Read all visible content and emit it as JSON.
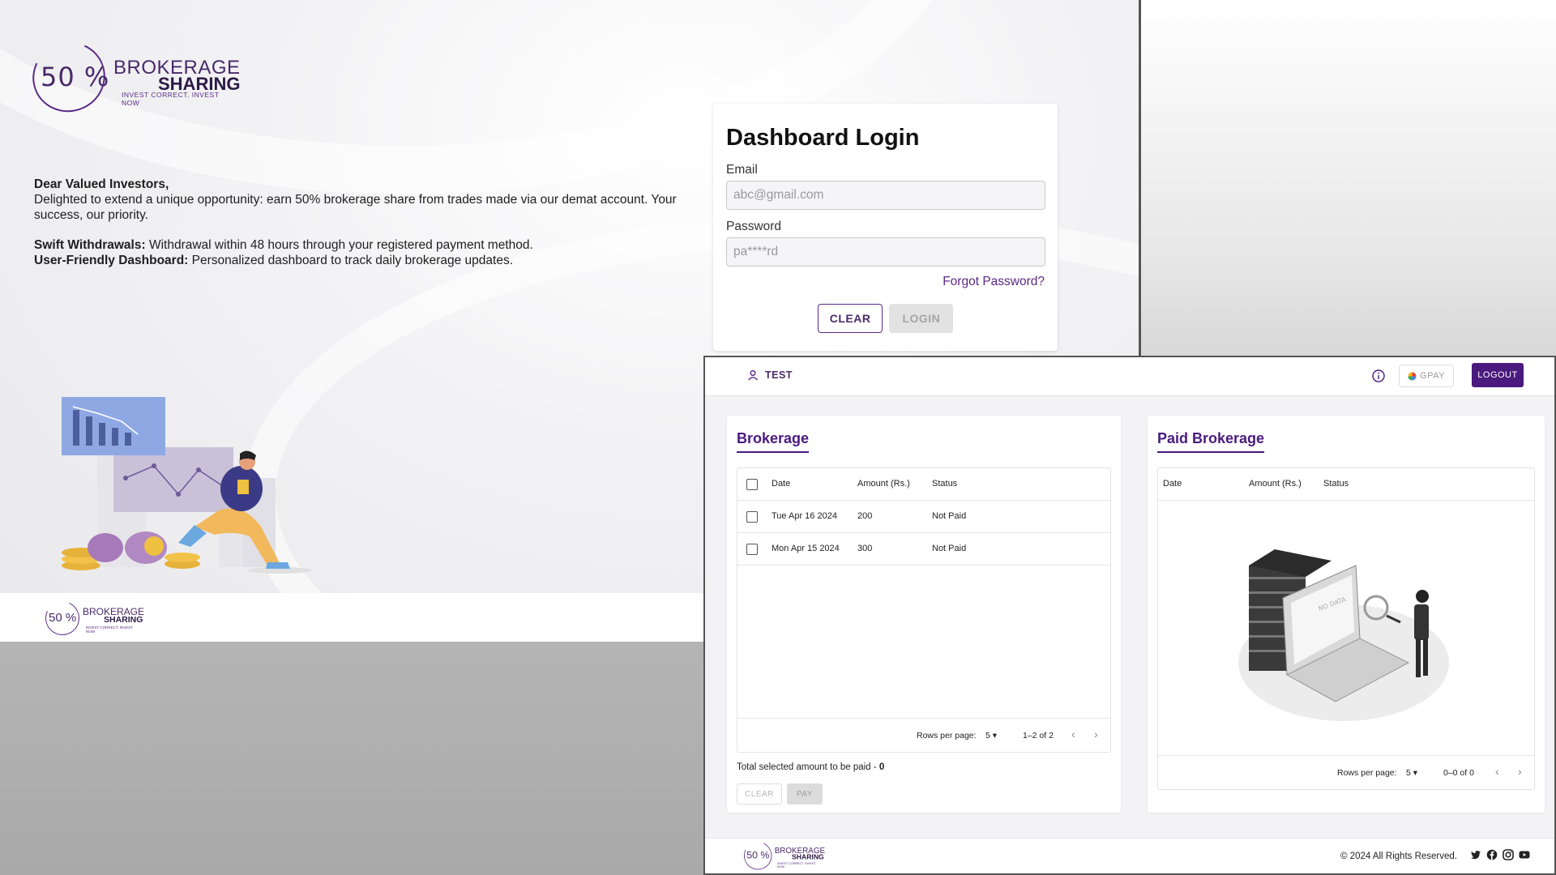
{
  "brand": {
    "percent": "50 %",
    "word1": "BROKERAGE",
    "word2": "SHARING",
    "tagline": "INVEST CORRECT. INVEST NOW"
  },
  "intro": {
    "greeting": "Dear Valued Investors,",
    "body": "Delighted to extend a unique opportunity: earn 50% brokerage share from trades made via our demat account. Your success, our priority.",
    "feature1_title": "Swift Withdrawals:",
    "feature1_text": " Withdrawal within 48 hours through your registered payment method.",
    "feature2_title": "User-Friendly Dashboard:",
    "feature2_text": " Personalized dashboard to track daily brokerage updates."
  },
  "login": {
    "title": "Dashboard Login",
    "email_label": "Email",
    "email_placeholder": "abc@gmail.com",
    "password_label": "Password",
    "password_placeholder": "pa****rd",
    "forgot": "Forgot Password?",
    "clear_label": "CLEAR",
    "login_label": "LOGIN"
  },
  "dashboard": {
    "user_name": "TEST",
    "gpay_label": "GPAY",
    "logout_label": "LOGOUT",
    "brokerage": {
      "title": "Brokerage",
      "columns": [
        "Date",
        "Amount (Rs.)",
        "Status"
      ],
      "rows": [
        {
          "date": "Tue Apr 16 2024",
          "amount": "200",
          "status": "Not Paid"
        },
        {
          "date": "Mon Apr 15 2024",
          "amount": "300",
          "status": "Not Paid"
        }
      ],
      "rows_per_page_label": "Rows per page:",
      "rows_per_page": "5",
      "range": "1–2 of 2",
      "total_label": "Total selected amount to be paid - ",
      "total_value": "0",
      "clear_label": "CLEAR",
      "pay_label": "PAY"
    },
    "paid": {
      "title": "Paid Brokerage",
      "columns": [
        "Date",
        "Amount (Rs.)",
        "Status"
      ],
      "empty_image_text": "NO DATA",
      "rows_per_page_label": "Rows per page:",
      "rows_per_page": "5",
      "range": "0–0 of 0"
    },
    "footer": {
      "copyright": "© 2024 All Rights Reserved.",
      "socials": [
        "twitter-icon",
        "facebook-icon",
        "instagram-icon",
        "youtube-icon"
      ]
    }
  },
  "colors": {
    "brand_purple": "#4a1a7e",
    "link_purple": "#5b2a86"
  }
}
